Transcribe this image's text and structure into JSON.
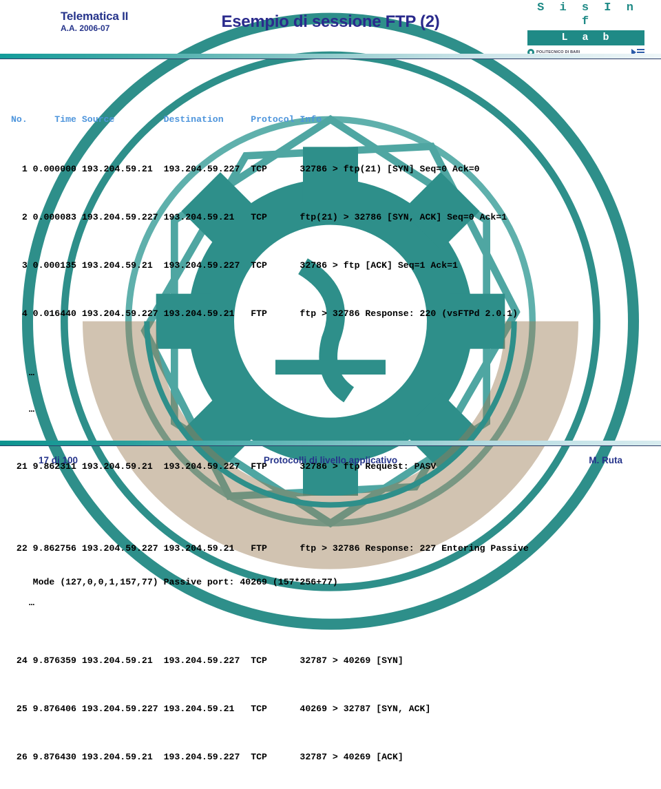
{
  "header": {
    "course_title": "Telematica II",
    "academic_year": "A.A. 2006-07",
    "slide_title": "Esempio di sessione FTP (2)",
    "logo": {
      "word": "S i s I n f",
      "bar": "L a b",
      "institution": "POLITECNICO DI BARI",
      "dept_logo": "DEE"
    }
  },
  "packet_list": {
    "columns_line": "No.     Time Source         Destination     Protocol Info",
    "rows": [
      {
        "no": "1",
        "time": "0.000000",
        "source": "193.204.59.21",
        "destination": "193.204.59.227",
        "protocol": "TCP",
        "info": "32786 > ftp(21) [SYN] Seq=0 Ack=0",
        "line": "  1 0.000000 193.204.59.21  193.204.59.227  TCP      32786 > ftp(21) [SYN] Seq=0 Ack=0"
      },
      {
        "no": "2",
        "time": "0.000083",
        "source": "193.204.59.227",
        "destination": "193.204.59.21",
        "protocol": "TCP",
        "info": "ftp(21) > 32786 [SYN, ACK] Seq=0 Ack=1",
        "line": "  2 0.000083 193.204.59.227 193.204.59.21   TCP      ftp(21) > 32786 [SYN, ACK] Seq=0 Ack=1"
      },
      {
        "no": "3",
        "time": "0.000135",
        "source": "193.204.59.21",
        "destination": "193.204.59.227",
        "protocol": "TCP",
        "info": "32786 > ftp [ACK] Seq=1 Ack=1",
        "line": "  3 0.000135 193.204.59.21  193.204.59.227  TCP      32786 > ftp [ACK] Seq=1 Ack=1"
      },
      {
        "no": "4",
        "time": "0.016440",
        "source": "193.204.59.227",
        "destination": "193.204.59.21",
        "protocol": "FTP",
        "info": "ftp > 32786 Response: 220 (vsFTPd 2.0.1)",
        "line": "  4 0.016440 193.204.59.227 193.204.59.21   FTP      ftp > 32786 Response: 220 (vsFTPd 2.0.1)"
      },
      {
        "no": "21",
        "time": "9.862311",
        "source": "193.204.59.21",
        "destination": "193.204.59.227",
        "protocol": "FTP",
        "info": "32786 > ftp Request: PASV",
        "line": " 21 9.862311 193.204.59.21  193.204.59.227  FTP      32786 > ftp Request: PASV"
      },
      {
        "no": "22",
        "time": "9.862756",
        "source": "193.204.59.227",
        "destination": "193.204.59.21",
        "protocol": "FTP",
        "info": "ftp > 32786 Response: 227 Entering Passive Mode (127,0,0,1,157,77) Passive port: 40269 (157*256+77)",
        "line": " 22 9.862756 193.204.59.227 193.204.59.21   FTP      ftp > 32786 Response: 227 Entering Passive",
        "line2": "    Mode (127,0,0,1,157,77) Passive port: 40269 (157*256+77)"
      },
      {
        "no": "24",
        "time": "9.876359",
        "source": "193.204.59.21",
        "destination": "193.204.59.227",
        "protocol": "TCP",
        "info": "32787 > 40269 [SYN]",
        "line": " 24 9.876359 193.204.59.21  193.204.59.227  TCP      32787 > 40269 [SYN]"
      },
      {
        "no": "25",
        "time": "9.876406",
        "source": "193.204.59.227",
        "destination": "193.204.59.21",
        "protocol": "TCP",
        "info": "40269 > 32787 [SYN, ACK]",
        "line": " 25 9.876406 193.204.59.227 193.204.59.21   TCP      40269 > 32787 [SYN, ACK]"
      },
      {
        "no": "26",
        "time": "9.876430",
        "source": "193.204.59.21",
        "destination": "193.204.59.227",
        "protocol": "TCP",
        "info": "32787 > 40269 [ACK]",
        "line": " 26 9.876430 193.204.59.21  193.204.59.227  TCP      32787 > 40269 [ACK]"
      }
    ],
    "ellipsis": "…"
  },
  "footer": {
    "page": "17 di 100",
    "subject": "Protocolli di livello applicativo",
    "author": "M. Ruta"
  },
  "colors": {
    "title_blue": "#2A2A8C",
    "course_blue": "#26348B",
    "header_col_blue": "#4E95DC",
    "teal": "#1F8A86",
    "body_black": "#000000"
  }
}
